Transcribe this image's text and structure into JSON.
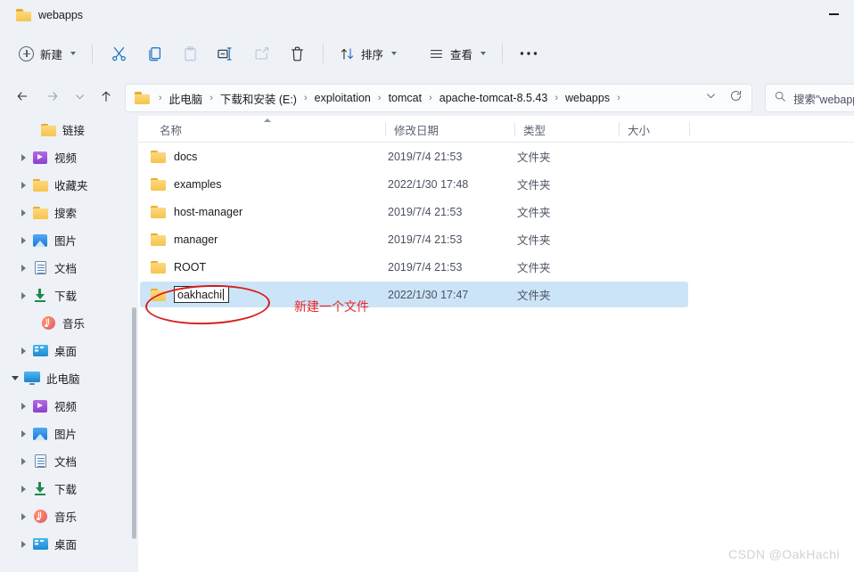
{
  "window": {
    "tab_title": "webapps",
    "tab_icon": "folder-icon",
    "minimize_label": "—"
  },
  "toolbar": {
    "new_label": "新建",
    "new_icon": "plus-circle-icon",
    "cut_icon": "scissors-icon",
    "copy_icon": "copy-icon",
    "paste_icon": "paste-icon",
    "rename_icon": "rename-icon",
    "share_icon": "share-icon",
    "delete_icon": "trash-icon",
    "sort_label": "排序",
    "sort_icon": "sort-arrows-icon",
    "view_label": "查看",
    "view_icon": "view-lines-icon",
    "more_label": "•••"
  },
  "address": {
    "back_icon": "arrow-left-icon",
    "forward_icon": "arrow-right-icon",
    "recent_icon": "chevron-down-icon",
    "up_icon": "arrow-up-icon",
    "crumb_icon": "folder-icon",
    "crumbs": [
      "此电脑",
      "下载和安装 (E:)",
      "exploitation",
      "tomcat",
      "apache-tomcat-8.5.43",
      "webapps"
    ],
    "separator": "›",
    "dropdown_icon": "chevron-down-icon",
    "refresh_icon": "refresh-icon"
  },
  "search": {
    "icon": "search-icon",
    "placeholder": "搜索\"webapps\"",
    "value": ""
  },
  "sidebar": {
    "items": [
      {
        "label": "链接",
        "icon": "folder-icon",
        "indent": 2,
        "expander": "none"
      },
      {
        "label": "视频",
        "icon": "video-icon",
        "indent": 1,
        "expander": "collapsed"
      },
      {
        "label": "收藏夹",
        "icon": "folder-icon",
        "indent": 1,
        "expander": "collapsed"
      },
      {
        "label": "搜索",
        "icon": "folder-icon",
        "indent": 1,
        "expander": "collapsed"
      },
      {
        "label": "图片",
        "icon": "picture-icon",
        "indent": 1,
        "expander": "collapsed"
      },
      {
        "label": "文档",
        "icon": "document-icon",
        "indent": 1,
        "expander": "collapsed"
      },
      {
        "label": "下载",
        "icon": "download-icon",
        "indent": 1,
        "expander": "collapsed"
      },
      {
        "label": "音乐",
        "icon": "music-icon",
        "indent": 2,
        "expander": "none"
      },
      {
        "label": "桌面",
        "icon": "desktop-icon",
        "indent": 1,
        "expander": "collapsed"
      },
      {
        "label": "此电脑",
        "icon": "this-pc-icon",
        "indent": 0,
        "expander": "expanded"
      },
      {
        "label": "视频",
        "icon": "video-icon",
        "indent": 1,
        "expander": "collapsed"
      },
      {
        "label": "图片",
        "icon": "picture-icon",
        "indent": 1,
        "expander": "collapsed"
      },
      {
        "label": "文档",
        "icon": "document-icon",
        "indent": 1,
        "expander": "collapsed"
      },
      {
        "label": "下载",
        "icon": "download-icon",
        "indent": 1,
        "expander": "collapsed"
      },
      {
        "label": "音乐",
        "icon": "music-icon",
        "indent": 1,
        "expander": "collapsed"
      },
      {
        "label": "桌面",
        "icon": "desktop-icon",
        "indent": 1,
        "expander": "collapsed"
      }
    ]
  },
  "filelist": {
    "columns": [
      {
        "key": "name",
        "label": "名称",
        "sorted": "asc"
      },
      {
        "key": "date",
        "label": "修改日期",
        "sorted": "none"
      },
      {
        "key": "type",
        "label": "类型",
        "sorted": "none"
      },
      {
        "key": "size",
        "label": "大小",
        "sorted": "none"
      }
    ],
    "rows": [
      {
        "name": "docs",
        "date": "2019/7/4 21:53",
        "type": "文件夹",
        "size": "",
        "selected": false,
        "editing": false
      },
      {
        "name": "examples",
        "date": "2022/1/30 17:48",
        "type": "文件夹",
        "size": "",
        "selected": false,
        "editing": false
      },
      {
        "name": "host-manager",
        "date": "2019/7/4 21:53",
        "type": "文件夹",
        "size": "",
        "selected": false,
        "editing": false
      },
      {
        "name": "manager",
        "date": "2019/7/4 21:53",
        "type": "文件夹",
        "size": "",
        "selected": false,
        "editing": false
      },
      {
        "name": "ROOT",
        "date": "2019/7/4 21:53",
        "type": "文件夹",
        "size": "",
        "selected": false,
        "editing": false
      },
      {
        "name": "oakhachi",
        "date": "2022/1/30 17:47",
        "type": "文件夹",
        "size": "",
        "selected": true,
        "editing": true
      }
    ],
    "rename_value": "oakhachi"
  },
  "annotations": {
    "circle_color": "#d81e1e",
    "note_text": "新建一个文件",
    "note_color": "#e8262a"
  },
  "watermark": {
    "text": "CSDN @OakHachi"
  },
  "colors": {
    "chrome_bg": "#eef1f6",
    "content_bg": "#ffffff",
    "selection": "#cce4f7",
    "folder": "#f7c34c",
    "accent": "#0f6cbd"
  }
}
